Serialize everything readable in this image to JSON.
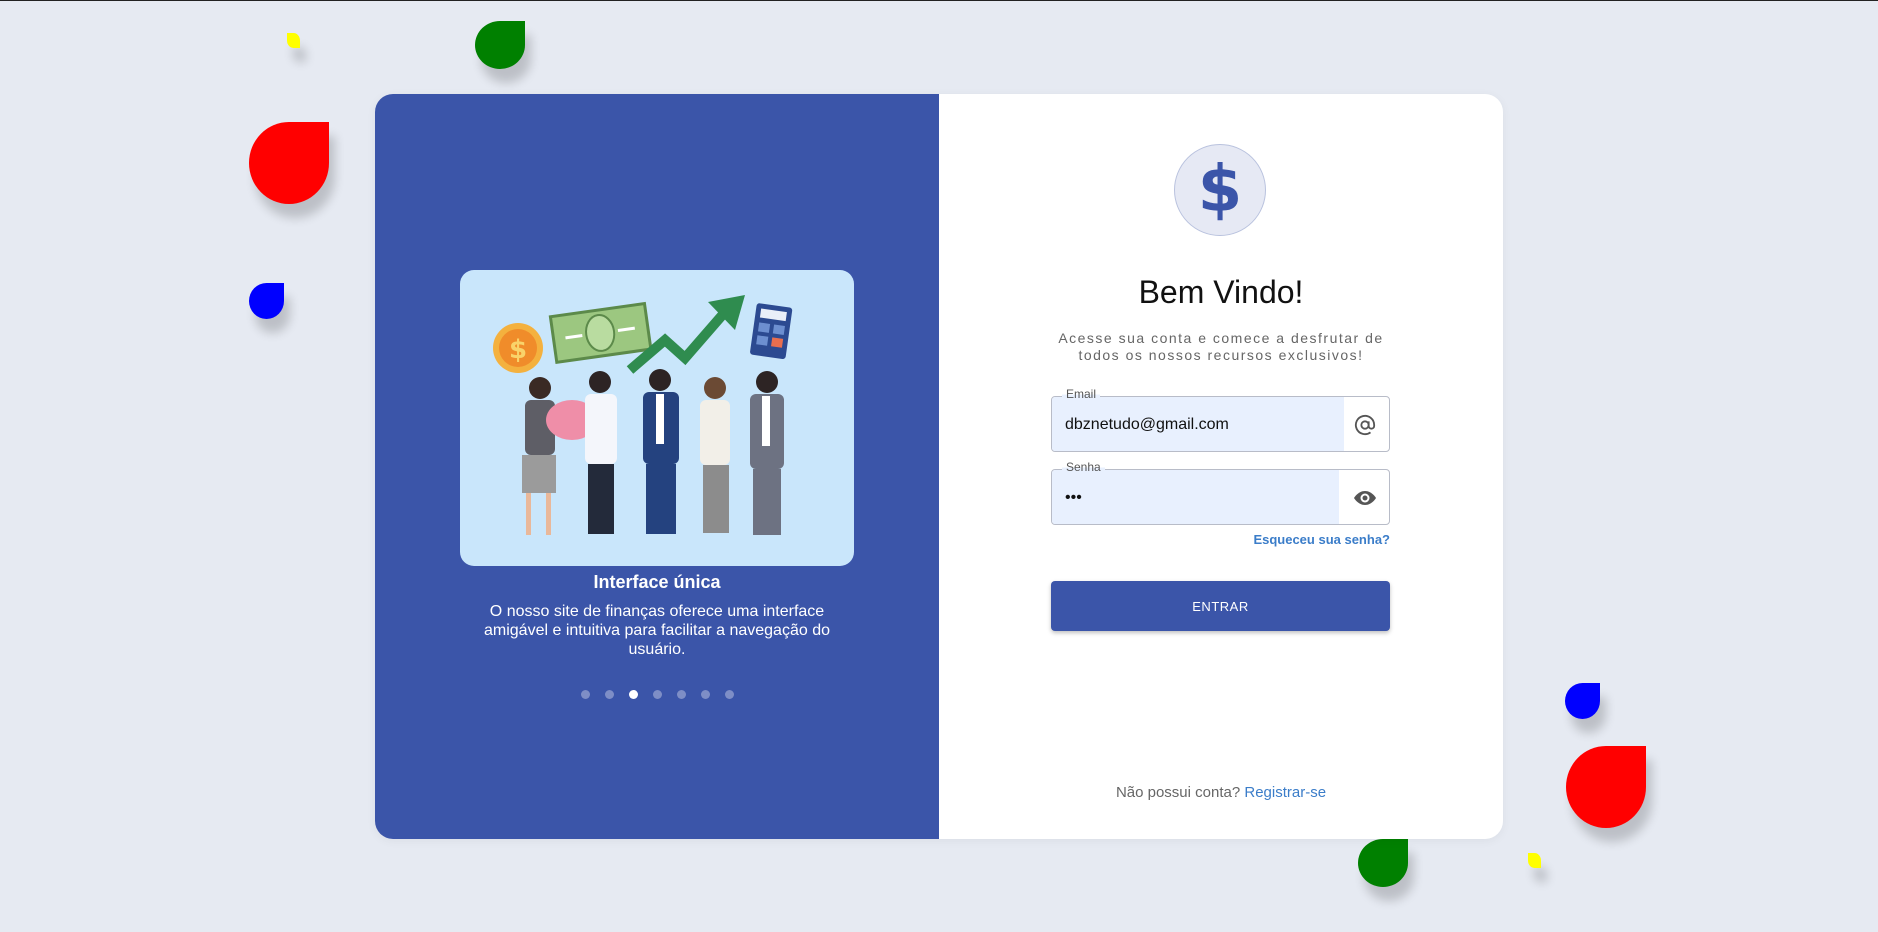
{
  "colors": {
    "background": "#e6eaf2",
    "primary": "#3b55a9",
    "link": "#3b7dc9",
    "input_fill": "#e8f0fe",
    "leaf_red": "#ff0000",
    "leaf_green": "#008000",
    "leaf_blue": "#0000ff",
    "leaf_yellow": "#ffff00"
  },
  "carousel": {
    "title": "Interface única",
    "text": "O nosso site de finanças oferece uma interface amigável e intuitiva para facilitar a navegação do usuário.",
    "dot_count": 7,
    "active_index": 2
  },
  "login": {
    "logo_symbol": "$",
    "heading": "Bem Vindo!",
    "subtitle": "Acesse sua conta e comece a desfrutar de todos os nossos recursos exclusivos!",
    "email_label": "Email",
    "email_value": "dbznetudo@gmail.com",
    "email_icon": "at-icon",
    "password_label": "Senha",
    "password_value": "•••",
    "password_icon": "eye-icon",
    "forgot_link": "Esqueceu sua senha?",
    "submit_label": "ENTRAR",
    "no_account_text": "Não possui conta?",
    "register_link": "Registrar-se"
  }
}
